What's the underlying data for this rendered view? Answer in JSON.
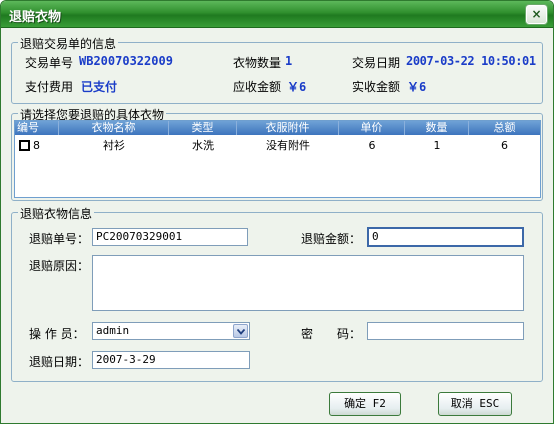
{
  "window": {
    "title": "退赔衣物"
  },
  "transaction": {
    "legend": "退赔交易单的信息",
    "order_no_label": "交易单号",
    "order_no": "WB20070322009",
    "item_count_label": "衣物数量",
    "item_count": "1",
    "trade_date_label": "交易日期",
    "trade_date": "2007-03-22 10:50:01",
    "pay_label": "支付费用",
    "pay_status": "已支付",
    "receivable_label": "应收金额",
    "receivable": "￥6",
    "received_label": "实收金额",
    "received": "￥6"
  },
  "items": {
    "legend": "请选择您要退赔的具体衣物",
    "columns": [
      "编号",
      "衣物名称",
      "类型",
      "衣服附件",
      "单价",
      "数量",
      "总额"
    ],
    "rows": [
      {
        "id": "8",
        "name": "衬衫",
        "type": "水洗",
        "attachment": "没有附件",
        "price": "6",
        "qty": "1",
        "total": "6",
        "checked": false
      }
    ]
  },
  "refund": {
    "legend": "退赔衣物信息",
    "refund_no_label": "退赔单号：",
    "refund_no": "PC20070329001",
    "refund_amount_label": "退赔金额：",
    "refund_amount": "0",
    "reason_label": "退赔原因：",
    "reason": "",
    "operator_label": "操 作 员：",
    "operator": "admin",
    "password_label": "密　　码：",
    "password": "",
    "date_label": "退赔日期：",
    "date": "2007-3-29"
  },
  "buttons": {
    "ok": "确定 F2",
    "cancel": "取消 ESC"
  }
}
